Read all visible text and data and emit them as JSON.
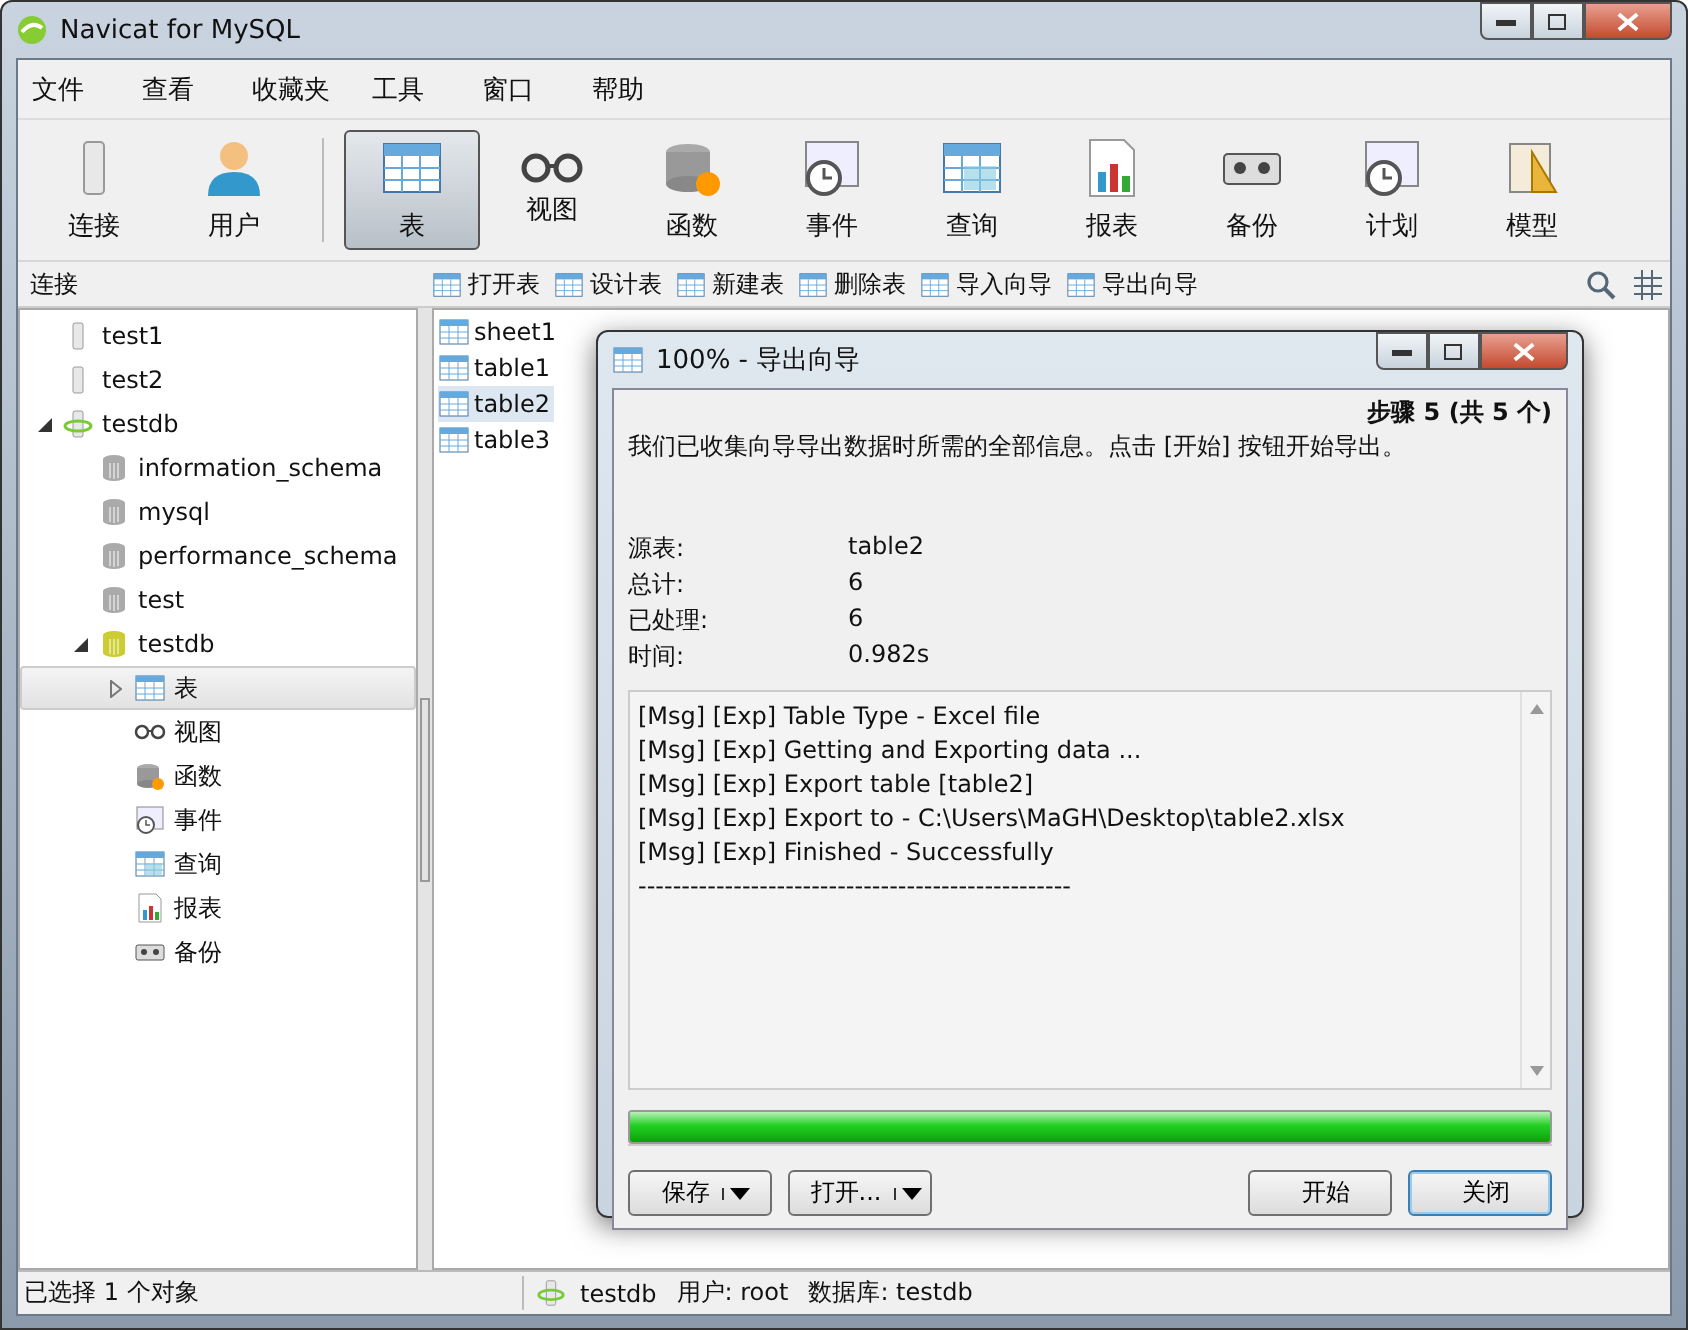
{
  "window": {
    "title": "Navicat for MySQL"
  },
  "menu": [
    "文件",
    "查看",
    "收藏夹",
    "工具",
    "窗口",
    "帮助"
  ],
  "toolbar": [
    {
      "label": "连接",
      "kind": "connection",
      "selected": false
    },
    {
      "label": "用户",
      "kind": "user",
      "selected": false
    },
    {
      "label": "表",
      "kind": "table",
      "selected": true
    },
    {
      "label": "视图",
      "kind": "view",
      "selected": false
    },
    {
      "label": "函数",
      "kind": "function",
      "selected": false
    },
    {
      "label": "事件",
      "kind": "event",
      "selected": false
    },
    {
      "label": "查询",
      "kind": "query",
      "selected": false
    },
    {
      "label": "报表",
      "kind": "report",
      "selected": false
    },
    {
      "label": "备份",
      "kind": "backup",
      "selected": false
    },
    {
      "label": "计划",
      "kind": "schedule",
      "selected": false
    },
    {
      "label": "模型",
      "kind": "model",
      "selected": false
    }
  ],
  "object_bar": {
    "title": "连接",
    "actions": [
      "打开表",
      "设计表",
      "新建表",
      "删除表",
      "导入向导",
      "导出向导"
    ]
  },
  "tree": [
    {
      "label": "test1",
      "kind": "connection",
      "selected": false
    },
    {
      "label": "test2",
      "kind": "connection",
      "selected": false
    },
    {
      "label": "testdb",
      "kind": "connection-open",
      "selected": false,
      "expanded": true,
      "children": [
        {
          "label": "information_schema",
          "kind": "database",
          "selected": false
        },
        {
          "label": "mysql",
          "kind": "database",
          "selected": false
        },
        {
          "label": "performance_schema",
          "kind": "database",
          "selected": false
        },
        {
          "label": "test",
          "kind": "database",
          "selected": false
        },
        {
          "label": "testdb",
          "kind": "database-open",
          "selected": false,
          "expanded": true,
          "children": [
            {
              "label": "表",
              "kind": "table",
              "selected": true,
              "expanded": false
            },
            {
              "label": "视图",
              "kind": "view",
              "selected": false
            },
            {
              "label": "函数",
              "kind": "function",
              "selected": false
            },
            {
              "label": "事件",
              "kind": "event",
              "selected": false
            },
            {
              "label": "查询",
              "kind": "query",
              "selected": false
            },
            {
              "label": "报表",
              "kind": "report",
              "selected": false
            },
            {
              "label": "备份",
              "kind": "backup",
              "selected": false
            }
          ]
        }
      ]
    }
  ],
  "objects": [
    {
      "label": "sheet1",
      "selected": false
    },
    {
      "label": "table1",
      "selected": false
    },
    {
      "label": "table2",
      "selected": true
    },
    {
      "label": "table3",
      "selected": false
    }
  ],
  "dialog": {
    "title": "100% - 导出向导",
    "step": "步骤 5 (共 5 个)",
    "message": "我们已收集向导导出数据时所需的全部信息。点击 [开始] 按钮开始导出。",
    "summary": [
      {
        "label": "源表:",
        "value": "table2"
      },
      {
        "label": "总计:",
        "value": "6"
      },
      {
        "label": "已处理:",
        "value": "6"
      },
      {
        "label": "时间:",
        "value": "0.982s"
      }
    ],
    "log": [
      "[Msg] [Exp] Table Type - Excel file",
      "[Msg] [Exp] Getting and Exporting data ...",
      "[Msg] [Exp] Export table [table2]",
      "[Msg] [Exp] Export to - C:\\Users\\MaGH\\Desktop\\table2.xlsx",
      "[Msg] [Exp] Finished - Successfully",
      "--------------------------------------------------"
    ],
    "progress": {
      "level": 1
    },
    "buttons": [
      {
        "label": "保存",
        "kind": "split",
        "default": false
      },
      {
        "label": "打开...",
        "kind": "split",
        "default": false
      },
      {
        "label": "开始",
        "kind": "push",
        "default": false
      },
      {
        "label": "关闭",
        "kind": "push",
        "default": true
      }
    ]
  },
  "status_bar": {
    "selection": "已选择 1 个对象",
    "connection": "testdb",
    "user": "用户: root",
    "database": "数据库: testdb"
  }
}
